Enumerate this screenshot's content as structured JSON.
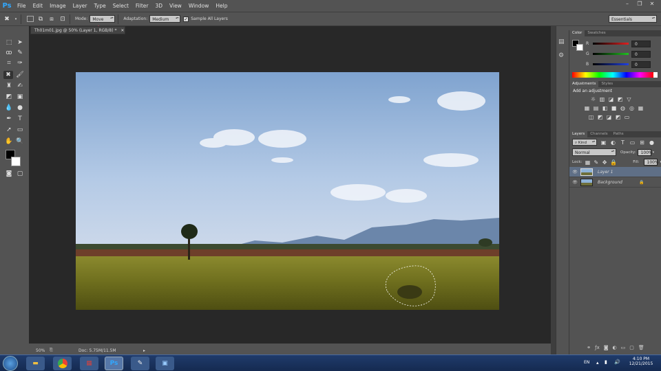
{
  "app": {
    "logo": "Ps"
  },
  "menu": [
    "File",
    "Edit",
    "Image",
    "Layer",
    "Type",
    "Select",
    "Filter",
    "3D",
    "View",
    "Window",
    "Help"
  ],
  "window_controls": [
    "minimize-icon",
    "restore-icon",
    "close-icon"
  ],
  "options": {
    "mode_label": "Mode:",
    "mode_value": "Move",
    "adaptation_label": "Adaptation:",
    "adaptation_value": "Medium",
    "sample_all_layers": "Sample All Layers",
    "workspace": "Essentials"
  },
  "document": {
    "tab_title": "Th01m01.jpg @ 50% (Layer 1, RGB/8) *",
    "zoom": "50%",
    "doc_size": "Doc: 5.75M/11.5M"
  },
  "color_panel": {
    "tabs": [
      "Color",
      "Swatches"
    ],
    "channels": [
      {
        "label": "R",
        "value": "0",
        "color": "#e02020"
      },
      {
        "label": "G",
        "value": "0",
        "color": "#20c020"
      },
      {
        "label": "B",
        "value": "0",
        "color": "#2040e0"
      }
    ]
  },
  "adjustments_panel": {
    "tabs": [
      "Adjustments",
      "Styles"
    ],
    "heading": "Add an adjustment"
  },
  "layers_panel": {
    "tabs": [
      "Layers",
      "Channels",
      "Paths"
    ],
    "filter_kind": "Kind",
    "blend_mode": "Normal",
    "opacity_label": "Opacity:",
    "opacity_value": "100%",
    "lock_label": "Lock:",
    "fill_label": "Fill:",
    "fill_value": "100%",
    "layers": [
      {
        "name": "Layer 1",
        "selected": true
      },
      {
        "name": "Background",
        "selected": false
      }
    ]
  },
  "taskbar": {
    "time": "4:10 PM",
    "date": "12/21/2015",
    "lang": "EN"
  },
  "colors": {
    "accent": "#31a8ff",
    "annotation_arrow": "#e8335a",
    "panel": "#535353",
    "canvas_bg": "#282828"
  }
}
